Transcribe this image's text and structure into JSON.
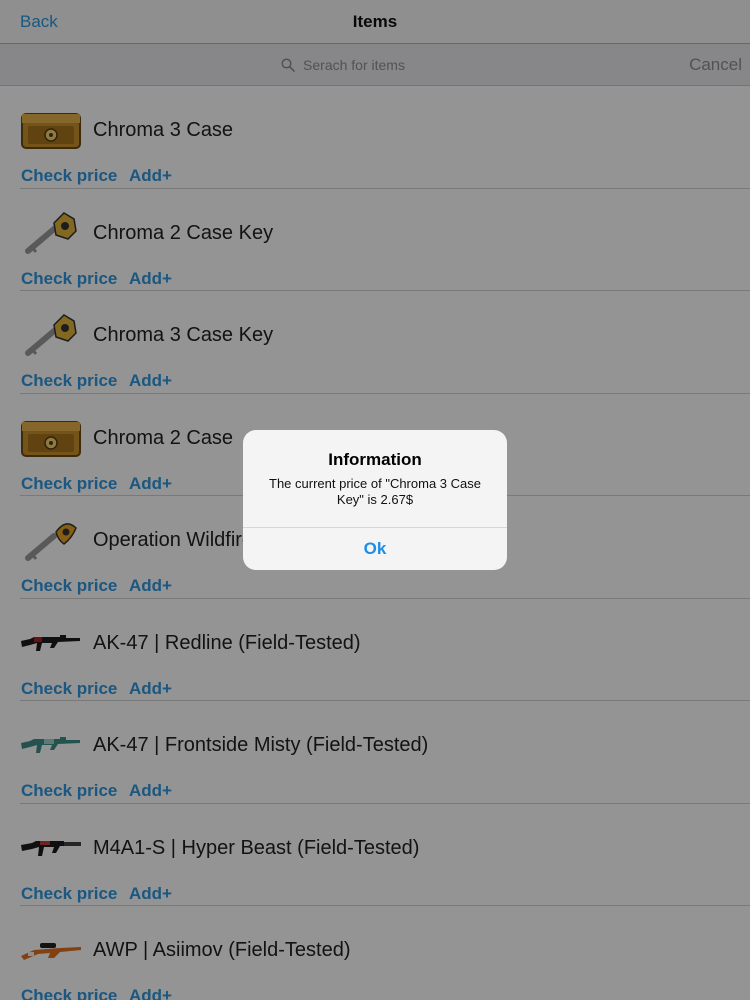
{
  "navbar": {
    "back_label": "Back",
    "title": "Items"
  },
  "search": {
    "placeholder": "Serach for items",
    "cancel_label": "Cancel"
  },
  "items": [
    {
      "name": "Chroma 3 Case",
      "icon": "case",
      "check_label": "Check price",
      "add_label": "Add+"
    },
    {
      "name": "Chroma 2 Case Key",
      "icon": "key",
      "check_label": "Check price",
      "add_label": "Add+"
    },
    {
      "name": "Chroma 3 Case Key",
      "icon": "key",
      "check_label": "Check price",
      "add_label": "Add+"
    },
    {
      "name": "Chroma 2 Case",
      "icon": "case",
      "check_label": "Check price",
      "add_label": "Add+"
    },
    {
      "name": "Operation Wildfire Case Key",
      "icon": "key",
      "check_label": "Check price",
      "add_label": "Add+"
    },
    {
      "name": "AK-47 | Redline (Field-Tested)",
      "icon": "ak-redline",
      "check_label": "Check price",
      "add_label": "Add+"
    },
    {
      "name": "AK-47 | Frontside Misty (Field-Tested)",
      "icon": "ak-misty",
      "check_label": "Check price",
      "add_label": "Add+"
    },
    {
      "name": "M4A1-S | Hyper Beast (Field-Tested)",
      "icon": "m4a1s",
      "check_label": "Check price",
      "add_label": "Add+"
    },
    {
      "name": "AWP | Asiimov (Field-Tested)",
      "icon": "awp",
      "check_label": "Check price",
      "add_label": "Add+"
    }
  ],
  "alert": {
    "title": "Information",
    "message": "The current price of \"Chroma 3 Case Key\" is 2.67$",
    "ok_label": "Ok"
  },
  "colors": {
    "accent": "#2f97dc",
    "overlay": "rgba(0,0,0,0.42)"
  }
}
